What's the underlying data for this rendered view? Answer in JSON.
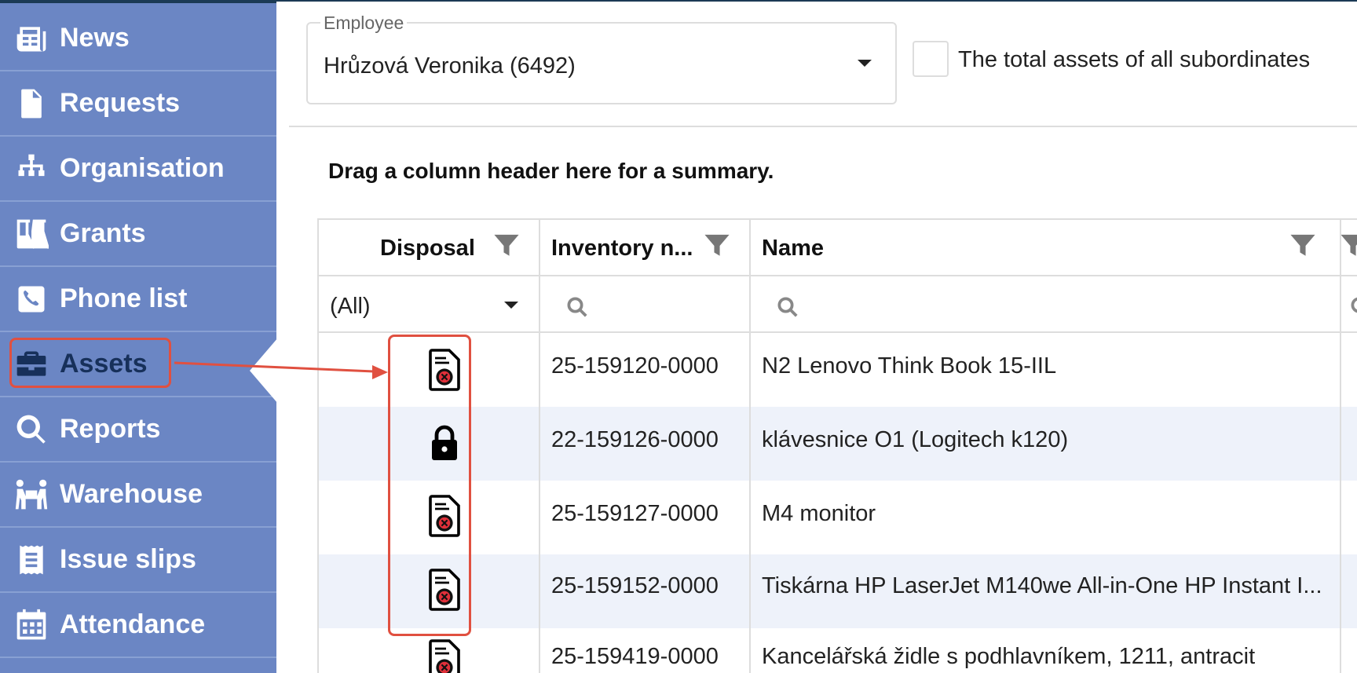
{
  "sidebar": {
    "items": [
      {
        "label": "News",
        "icon": "newspaper-icon"
      },
      {
        "label": "Requests",
        "icon": "document-signature-icon"
      },
      {
        "label": "Organisation",
        "icon": "org-chart-icon"
      },
      {
        "label": "Grants",
        "icon": "flask-icon"
      },
      {
        "label": "Phone list",
        "icon": "phone-icon"
      },
      {
        "label": "Assets",
        "icon": "briefcase-icon",
        "active": true
      },
      {
        "label": "Reports",
        "icon": "search-icon"
      },
      {
        "label": "Warehouse",
        "icon": "people-carry-icon"
      },
      {
        "label": "Issue slips",
        "icon": "receipt-icon"
      },
      {
        "label": "Attendance",
        "icon": "calendar-icon"
      }
    ]
  },
  "filters": {
    "employee_caption": "Employee",
    "employee_value": "Hrůzová Veronika (6492)",
    "subordinates_label": "The total assets of all subordinates",
    "subordinates_checked": false
  },
  "grid": {
    "group_hint": "Drag a column header here for a summary.",
    "columns": {
      "disposal": "Disposal",
      "inventory": "Inventory n...",
      "name": "Name"
    },
    "disposal_filter_value": "(All)",
    "rows": [
      {
        "disposal_icon": "disposal-document-icon",
        "inventory": "25-159120-0000",
        "name": "N2 Lenovo Think Book 15-IIL"
      },
      {
        "disposal_icon": "lock-icon",
        "inventory": "22-159126-0000",
        "name": "klávesnice O1 (Logitech k120)"
      },
      {
        "disposal_icon": "disposal-document-icon",
        "inventory": "25-159127-0000",
        "name": "M4 monitor"
      },
      {
        "disposal_icon": "disposal-document-icon",
        "inventory": "25-159152-0000",
        "name": "Tiskárna HP LaserJet M140we All-in-One HP Instant I..."
      },
      {
        "disposal_icon": "disposal-document-icon",
        "inventory": "25-159419-0000",
        "name": "Kancelářská židle s podhlavníkem, 1211, antracit"
      }
    ]
  },
  "colors": {
    "sidebar_bg": "#6b86c4",
    "active_text": "#17305a",
    "highlight": "#e05040",
    "row_alt": "#eef2fa"
  }
}
